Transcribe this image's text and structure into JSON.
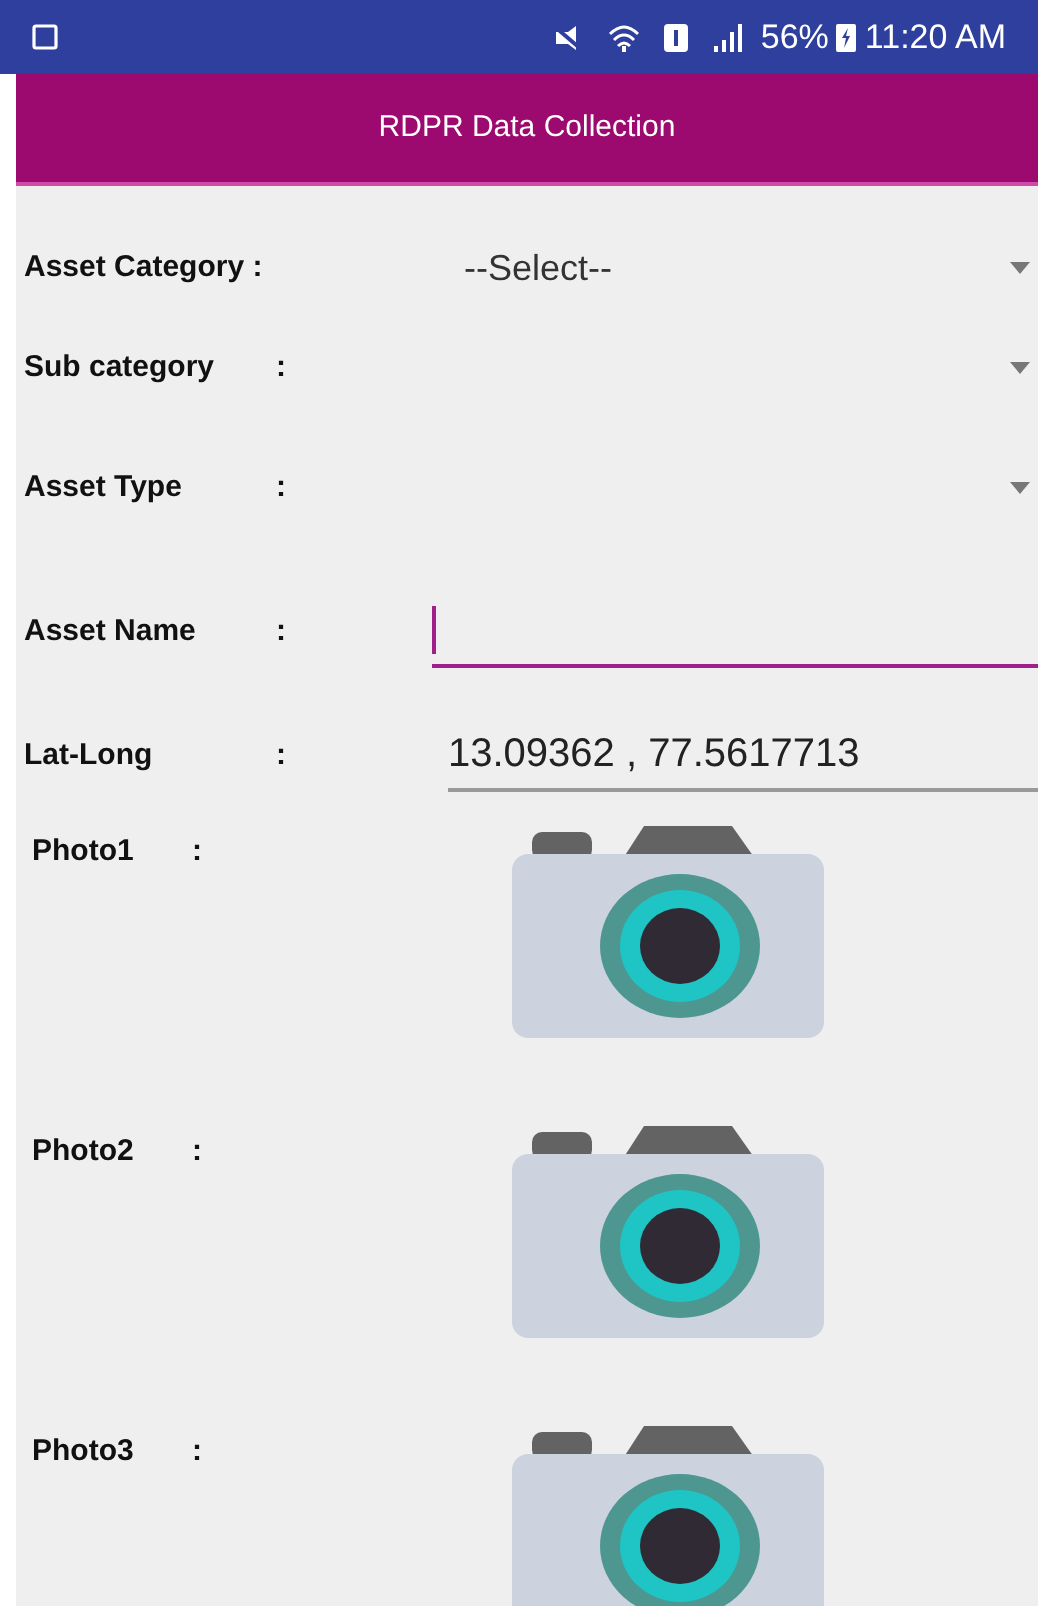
{
  "status_bar": {
    "battery": "56%",
    "time": "11:20 AM"
  },
  "app_bar": {
    "title": "RDPR Data Collection"
  },
  "fields": [
    {
      "kind": "dropdown",
      "label": "Asset Category :",
      "value": "--Select--"
    },
    {
      "kind": "dropdown",
      "label": "Sub category",
      "colon": ":"
    },
    {
      "kind": "dropdown",
      "label": "Asset Type",
      "colon": ":"
    },
    {
      "kind": "text",
      "label": "Asset Name",
      "colon": ":",
      "focused": true
    },
    {
      "kind": "text",
      "label": "Lat-Long",
      "colon": ":",
      "value": "13.09362 , 77.5617713",
      "focused": false
    }
  ],
  "photos": [
    {
      "label": "Photo1",
      "colon": ":"
    },
    {
      "label": "Photo2",
      "colon": ":"
    },
    {
      "label": "Photo3",
      "colon": ":"
    }
  ]
}
